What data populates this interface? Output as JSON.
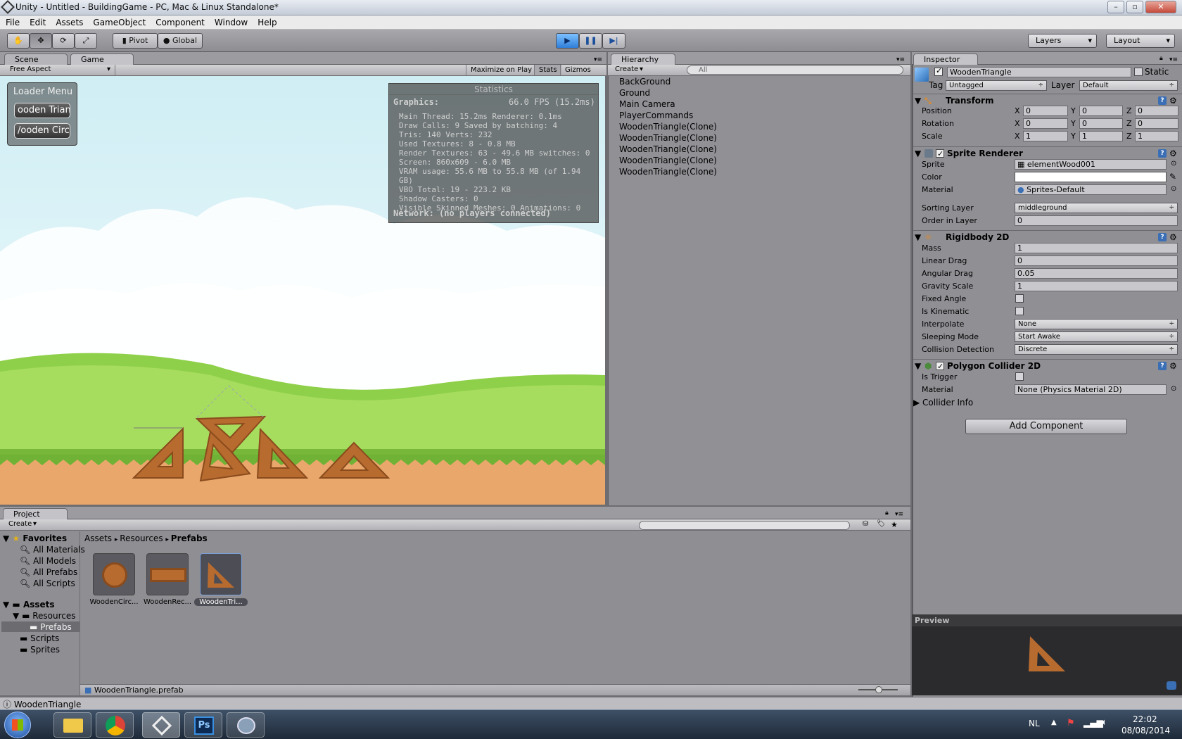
{
  "window": {
    "title": "Unity - Untitled - BuildingGame - PC, Mac & Linux Standalone*"
  },
  "menu": [
    "File",
    "Edit",
    "Assets",
    "GameObject",
    "Component",
    "Window",
    "Help"
  ],
  "toolbar": {
    "pivot": "Pivot",
    "global": "Global",
    "layers": "Layers",
    "layout": "Layout"
  },
  "scene_tab": "Scene",
  "game": {
    "tab": "Game",
    "aspect": "Free Aspect",
    "maximize": "Maximize on Play",
    "stats": "Stats",
    "gizmos": "Gizmos",
    "loader_title": "Loader Menu",
    "btn1": "ooden Trian",
    "btn2": "/ooden Circl",
    "stats_title": "Statistics",
    "graphics": "Graphics:",
    "fps": "66.0 FPS (15.2ms)",
    "lines": [
      "Main Thread: 15.2ms  Renderer: 0.1ms",
      "Draw Calls: 9   Saved by batching: 4",
      "Tris: 140  Verts: 232",
      "Used Textures: 8 - 0.8 MB",
      "Render Textures: 63 - 49.6 MB  switches: 0",
      "Screen: 860x609 - 6.0 MB",
      "VRAM usage: 55.6 MB to 55.8 MB (of 1.94 GB)",
      "VBO Total: 19 - 223.2 KB",
      "Shadow Casters: 0",
      "Visible Skinned Meshes: 0     Animations: 0"
    ],
    "network": "Network: (no players connected)"
  },
  "hierarchy": {
    "tab": "Hierarchy",
    "create": "Create",
    "search": "All",
    "items": [
      "BackGround",
      "Ground",
      "Main Camera",
      "PlayerCommands",
      "WoodenTriangle(Clone)",
      "WoodenTriangle(Clone)",
      "WoodenTriangle(Clone)",
      "WoodenTriangle(Clone)",
      "WoodenTriangle(Clone)"
    ]
  },
  "inspector": {
    "tab": "Inspector",
    "name": "WoodenTriangle",
    "static": "Static",
    "tag_label": "Tag",
    "tag": "Untagged",
    "layer_label": "Layer",
    "layer": "Default",
    "transform": {
      "title": "Transform",
      "rows": [
        {
          "label": "Position",
          "x": "0",
          "y": "0",
          "z": "0"
        },
        {
          "label": "Rotation",
          "x": "0",
          "y": "0",
          "z": "0"
        },
        {
          "label": "Scale",
          "x": "1",
          "y": "1",
          "z": "1"
        }
      ]
    },
    "sprite_renderer": {
      "title": "Sprite Renderer",
      "sprite_label": "Sprite",
      "sprite": "elementWood001",
      "color_label": "Color",
      "material_label": "Material",
      "material": "Sprites-Default",
      "sorting_label": "Sorting Layer",
      "sorting": "middleground",
      "order_label": "Order in Layer",
      "order": "0"
    },
    "rigidbody": {
      "title": "Rigidbody 2D",
      "mass_label": "Mass",
      "mass": "1",
      "lin_label": "Linear Drag",
      "lin": "0",
      "ang_label": "Angular Drag",
      "ang": "0.05",
      "grav_label": "Gravity Scale",
      "grav": "1",
      "fixed_label": "Fixed Angle",
      "kin_label": "Is Kinematic",
      "interp_label": "Interpolate",
      "interp": "None",
      "sleep_label": "Sleeping Mode",
      "sleep": "Start Awake",
      "coll_label": "Collision Detection",
      "coll": "Discrete"
    },
    "collider": {
      "title": "Polygon Collider 2D",
      "trigger_label": "Is Trigger",
      "material_label": "Material",
      "material": "None (Physics Material 2D)",
      "info": "Collider Info"
    },
    "add": "Add Component",
    "preview": "Preview"
  },
  "project": {
    "tab": "Project",
    "create": "Create",
    "favorites": "Favorites",
    "fav_items": [
      "All Materials",
      "All Models",
      "All Prefabs",
      "All Scripts"
    ],
    "assets": "Assets",
    "tree": [
      "Resources",
      "Prefabs",
      "Scripts",
      "Sprites"
    ],
    "breadcrumb": [
      "Assets",
      "Resources",
      "Prefabs"
    ],
    "items": [
      "WoodenCirc...",
      "WoodenRec...",
      "WoodenTri..."
    ],
    "selected_file": "WoodenTriangle.prefab"
  },
  "status": "WoodenTriangle",
  "taskbar": {
    "lang": "NL",
    "time": "22:02",
    "date": "08/08/2014"
  }
}
